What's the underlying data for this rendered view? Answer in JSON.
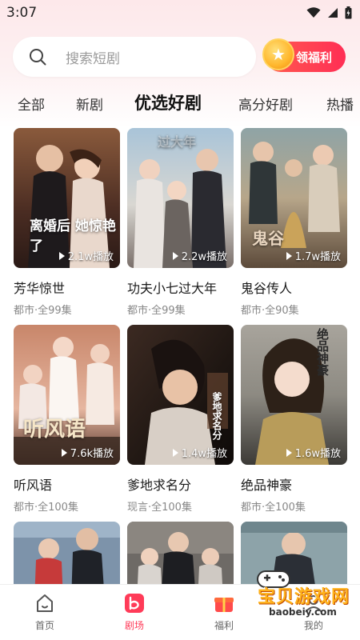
{
  "status_bar": {
    "time": "3:07",
    "icons": [
      "wifi-icon",
      "signal-icon",
      "battery-icon"
    ]
  },
  "search": {
    "placeholder": "搜索短剧",
    "icon": "search-icon"
  },
  "welfare_button": {
    "label": "领福利",
    "icon": "star-coin-icon"
  },
  "tabs": [
    {
      "label": "全部",
      "active": false
    },
    {
      "label": "新剧",
      "active": false
    },
    {
      "label": "优选好剧",
      "active": true
    },
    {
      "label": "高分好剧",
      "active": false
    },
    {
      "label": "热播"
    }
  ],
  "dramas": [
    {
      "title": "芳华惊世",
      "meta": "都市·全99集",
      "plays": "2.1w播放",
      "poster_text": "离婚后 她惊艳了"
    },
    {
      "title": "功夫小七过大年",
      "meta": "都市·全99集",
      "plays": "2.2w播放",
      "poster_text": "过大年"
    },
    {
      "title": "鬼谷传人",
      "meta": "都市·全90集",
      "plays": "1.7w播放",
      "poster_text": "鬼谷"
    },
    {
      "title": "听风语",
      "meta": "都市·全100集",
      "plays": "7.6k播放",
      "poster_text": "听风语"
    },
    {
      "title": "爹地求名分",
      "meta": "现言·全100集",
      "plays": "1.4w播放",
      "poster_text": "爹地求名分"
    },
    {
      "title": "绝品神豪",
      "meta": "都市·全100集",
      "plays": "1.6w播放",
      "poster_text": "绝品神豪"
    },
    {
      "title": "",
      "meta": "",
      "plays": "",
      "poster_text": ""
    },
    {
      "title": "",
      "meta": "",
      "plays": "",
      "poster_text": ""
    },
    {
      "title": "",
      "meta": "",
      "plays": "",
      "poster_text": ""
    }
  ],
  "bottom_nav": [
    {
      "label": "首页",
      "icon": "home-icon",
      "active": false
    },
    {
      "label": "剧场",
      "icon": "theater-icon",
      "active": true
    },
    {
      "label": "福利",
      "icon": "gift-icon",
      "active": false
    },
    {
      "label": "我的",
      "icon": "profile-icon",
      "active": false
    }
  ],
  "watermark": {
    "title": "宝贝游戏网",
    "url": "baobeiy.com"
  },
  "colors": {
    "accent": "#ff3b58",
    "welfare_gradient_start": "#ff5a4f",
    "welfare_gradient_end": "#ff2e55",
    "header_bg": "#fde8ea"
  }
}
